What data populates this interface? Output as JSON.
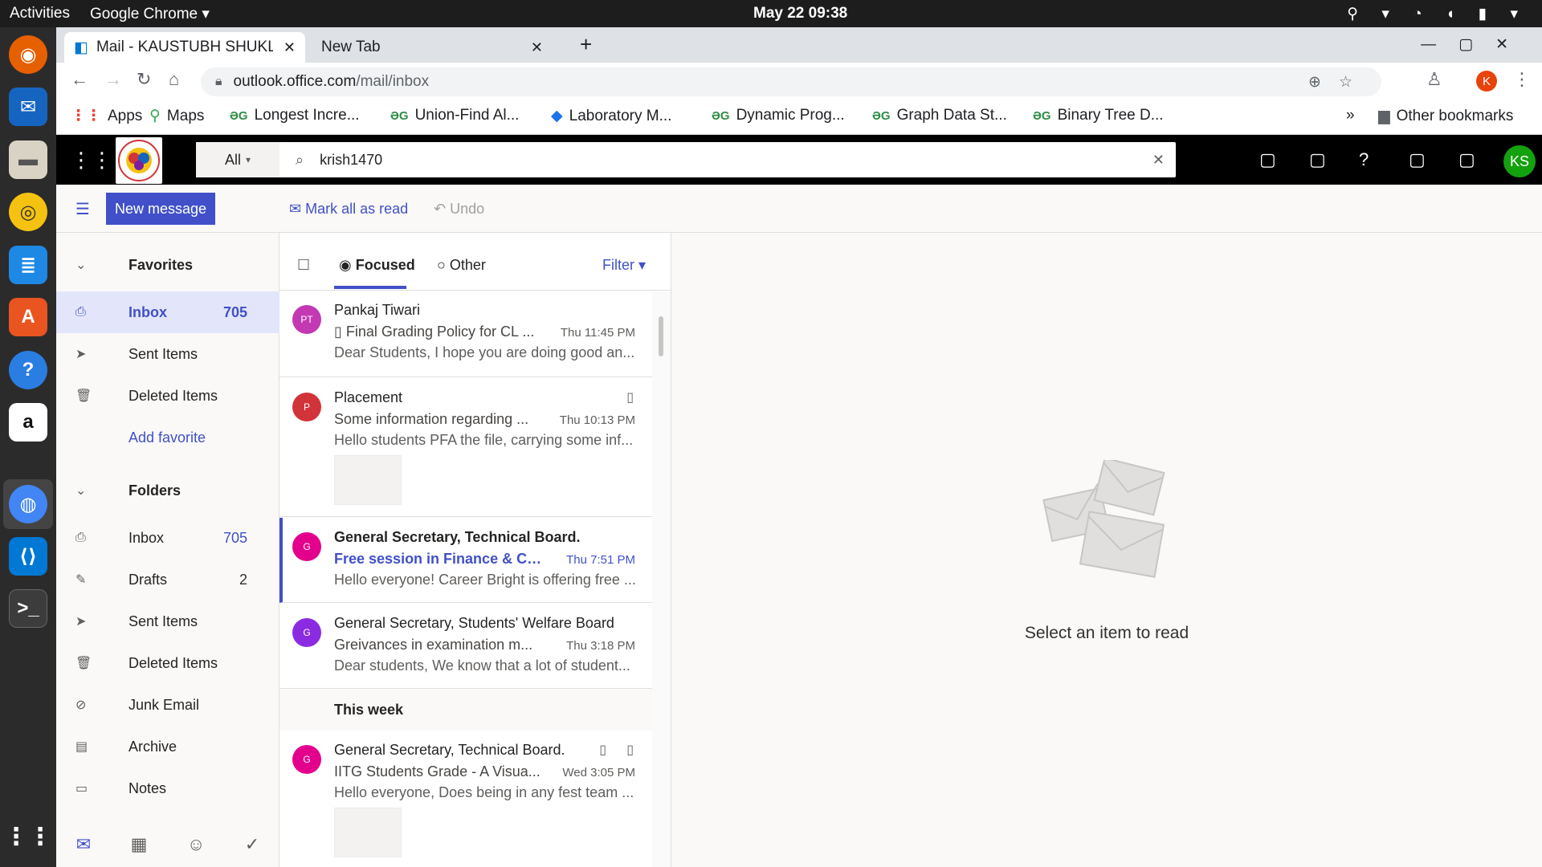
{
  "os": {
    "activities": "Activities",
    "app": "Google Chrome ▾",
    "clock": "May 22  09:38",
    "tray": "⚲ ▾  ◔ ◖ ▮ ▾"
  },
  "browser": {
    "tabs": [
      {
        "title": "Mail - KAUSTUBH SHUKLA",
        "close": "✕"
      },
      {
        "title": "New Tab",
        "close": "✕"
      }
    ],
    "new_tab": "+",
    "window_controls": "—▢✕",
    "url_host": "outlook.office.com",
    "url_path": "/mail/inbox",
    "profile_initial": "K",
    "bookmarks": [
      "Apps",
      "Maps",
      "Longest Incre...",
      "Union-Find Al...",
      "Laboratory M...",
      "Dynamic Prog...",
      "Graph Data St...",
      "Binary Tree D..."
    ],
    "bookmarks_more": "»",
    "other_bookmarks": "Other bookmarks"
  },
  "outlook": {
    "search_scope": "All",
    "search_value": "krish1470",
    "help": "?",
    "user_initials": "KS",
    "new_message": "New message",
    "mark_all_read": "Mark all as read",
    "undo": "Undo",
    "favorites": {
      "label": "Favorites",
      "items": [
        {
          "label": "Inbox",
          "count": "705"
        },
        {
          "label": "Sent Items",
          "count": ""
        },
        {
          "label": "Deleted Items",
          "count": ""
        }
      ],
      "add": "Add favorite"
    },
    "folders": {
      "label": "Folders",
      "items": [
        {
          "label": "Inbox",
          "count": "705"
        },
        {
          "label": "Drafts",
          "count": "2"
        },
        {
          "label": "Sent Items",
          "count": ""
        },
        {
          "label": "Deleted Items",
          "count": ""
        },
        {
          "label": "Junk Email",
          "count": ""
        },
        {
          "label": "Archive",
          "count": ""
        },
        {
          "label": "Notes",
          "count": ""
        }
      ]
    },
    "pivots": {
      "focused": "Focused",
      "other": "Other",
      "filter": "Filter"
    },
    "messages": [
      {
        "initials": "PT",
        "color": "#c239b3",
        "sender": "Pankaj Tiwari",
        "subject": "Final Grading Policy for CL ...",
        "time": "Thu 11:45 PM",
        "preview": "Dear Students, I hope you are doing good an..."
      },
      {
        "initials": "P",
        "color": "#d13438",
        "sender": "Placement",
        "subject": "Some information regarding ...",
        "time": "Thu 10:13 PM",
        "preview": "Hello students PFA the file, carrying some inf..."
      },
      {
        "initials": "G",
        "color": "#e3008c",
        "sender": "General Secretary, Technical Board.",
        "subject": "Free session in Finance & Co...",
        "time": "Thu 7:51 PM",
        "preview": "Hello everyone! Career Bright is offering free ..."
      },
      {
        "initials": "G",
        "color": "#8a2be2",
        "sender": "General Secretary, Students' Welfare Board",
        "subject": "Greivances in examination m...",
        "time": "Thu 3:18 PM",
        "preview": "Dear students, We know that a lot of student..."
      },
      {
        "initials": "G",
        "color": "#e3008c",
        "sender": "General Secretary, Technical Board.",
        "subject": "IITG Students Grade - A Visua...",
        "time": "Wed 3:05 PM",
        "preview": "Hello everyone, Does being in any fest team ..."
      }
    ],
    "week_header": "This week",
    "reading_empty": "Select an item to read"
  },
  "colors": {
    "accent": "#4150c8",
    "header": "#000000",
    "avatar": "#13a10e"
  }
}
